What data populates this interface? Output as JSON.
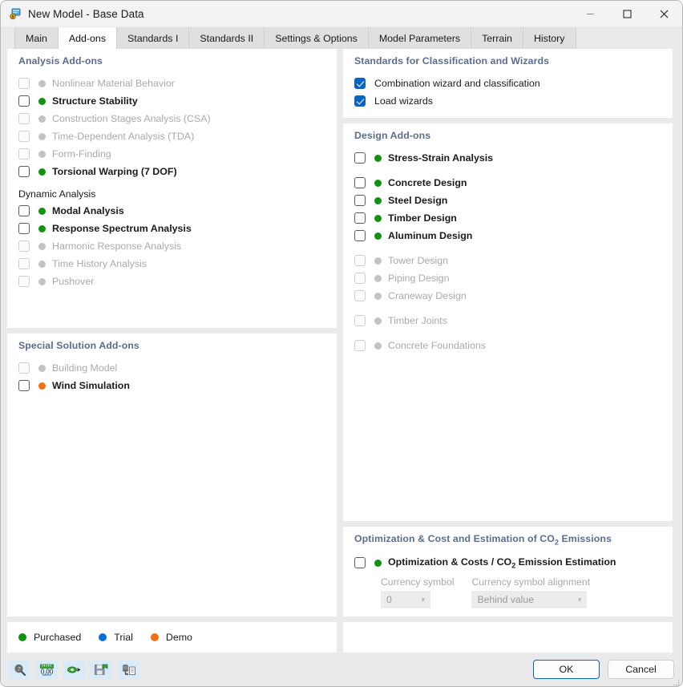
{
  "window": {
    "title": "New Model - Base Data",
    "icon": "model-document-icon",
    "controls": {
      "minimize": "–",
      "maximize": "☐",
      "close": "✕"
    }
  },
  "tabs": [
    {
      "label": "Main",
      "active": false
    },
    {
      "label": "Add-ons",
      "active": true
    },
    {
      "label": "Standards I",
      "active": false
    },
    {
      "label": "Standards II",
      "active": false
    },
    {
      "label": "Settings & Options",
      "active": false
    },
    {
      "label": "Model Parameters",
      "active": false
    },
    {
      "label": "Terrain",
      "active": false
    },
    {
      "label": "History",
      "active": false
    }
  ],
  "left": {
    "analysis": {
      "title": "Analysis Add-ons",
      "items": [
        {
          "label": "Nonlinear Material Behavior",
          "status": "grey",
          "checked": false,
          "enabled": false
        },
        {
          "label": "Structure Stability",
          "status": "green",
          "checked": false,
          "enabled": true
        },
        {
          "label": "Construction Stages Analysis (CSA)",
          "status": "grey",
          "checked": false,
          "enabled": false
        },
        {
          "label": "Time-Dependent Analysis (TDA)",
          "status": "grey",
          "checked": false,
          "enabled": false
        },
        {
          "label": "Form-Finding",
          "status": "grey",
          "checked": false,
          "enabled": false
        },
        {
          "label": "Torsional Warping (7 DOF)",
          "status": "green",
          "checked": false,
          "enabled": true
        }
      ],
      "subheading": "Dynamic Analysis",
      "dynamic_items": [
        {
          "label": "Modal Analysis",
          "status": "green",
          "checked": false,
          "enabled": true
        },
        {
          "label": "Response Spectrum Analysis",
          "status": "green",
          "checked": false,
          "enabled": true
        },
        {
          "label": "Harmonic Response Analysis",
          "status": "grey",
          "checked": false,
          "enabled": false
        },
        {
          "label": "Time History Analysis",
          "status": "grey",
          "checked": false,
          "enabled": false
        },
        {
          "label": "Pushover",
          "status": "grey",
          "checked": false,
          "enabled": false
        }
      ]
    },
    "special": {
      "title": "Special Solution Add-ons",
      "items": [
        {
          "label": "Building Model",
          "status": "grey",
          "checked": false,
          "enabled": false
        },
        {
          "label": "Wind Simulation",
          "status": "orange",
          "checked": false,
          "enabled": true
        }
      ]
    },
    "legend": {
      "items": [
        {
          "label": "Purchased",
          "status": "green"
        },
        {
          "label": "Trial",
          "status": "blue"
        },
        {
          "label": "Demo",
          "status": "orange"
        }
      ]
    }
  },
  "right": {
    "standards": {
      "title": "Standards for Classification and Wizards",
      "items": [
        {
          "label": "Combination wizard and classification",
          "checked": true,
          "enabled": true
        },
        {
          "label": "Load wizards",
          "checked": true,
          "enabled": true
        }
      ]
    },
    "design": {
      "title": "Design Add-ons",
      "group1": [
        {
          "label": "Stress-Strain Analysis",
          "status": "green",
          "checked": false,
          "enabled": true
        }
      ],
      "group2": [
        {
          "label": "Concrete Design",
          "status": "green",
          "checked": false,
          "enabled": true
        },
        {
          "label": "Steel Design",
          "status": "green",
          "checked": false,
          "enabled": true
        },
        {
          "label": "Timber Design",
          "status": "green",
          "checked": false,
          "enabled": true
        },
        {
          "label": "Aluminum Design",
          "status": "green",
          "checked": false,
          "enabled": true
        }
      ],
      "group3": [
        {
          "label": "Tower Design",
          "status": "grey",
          "checked": false,
          "enabled": false
        },
        {
          "label": "Piping Design",
          "status": "grey",
          "checked": false,
          "enabled": false
        },
        {
          "label": "Craneway Design",
          "status": "grey",
          "checked": false,
          "enabled": false
        }
      ],
      "group4": [
        {
          "label": "Timber Joints",
          "status": "grey",
          "checked": false,
          "enabled": false
        }
      ],
      "group5": [
        {
          "label": "Concrete Foundations",
          "status": "grey",
          "checked": false,
          "enabled": false
        }
      ]
    },
    "optimization": {
      "title_pre": "Optimization & Cost and Estimation of CO",
      "title_sub": "2",
      "title_post": " Emissions",
      "item_pre": "Optimization & Costs / CO",
      "item_sub": "2",
      "item_post": " Emission Estimation",
      "item_status": "green",
      "item_checked": false,
      "currency_symbol": {
        "label": "Currency symbol",
        "value": "0"
      },
      "currency_alignment": {
        "label": "Currency symbol alignment",
        "value": "Behind value"
      }
    }
  },
  "footer": {
    "tools": [
      {
        "name": "help-magnifier-icon"
      },
      {
        "name": "units-ruler-icon"
      },
      {
        "name": "currency-export-icon"
      },
      {
        "name": "save-template-icon"
      },
      {
        "name": "copy-data-icon"
      }
    ],
    "ok_label": "OK",
    "cancel_label": "Cancel"
  },
  "colors": {
    "accent": "#0a64c8",
    "purchased": "#119311",
    "trial": "#0b6fdb",
    "demo": "#f36f10",
    "panel_title": "#5b6c8f",
    "disabled_text": "#aaaaaa"
  }
}
